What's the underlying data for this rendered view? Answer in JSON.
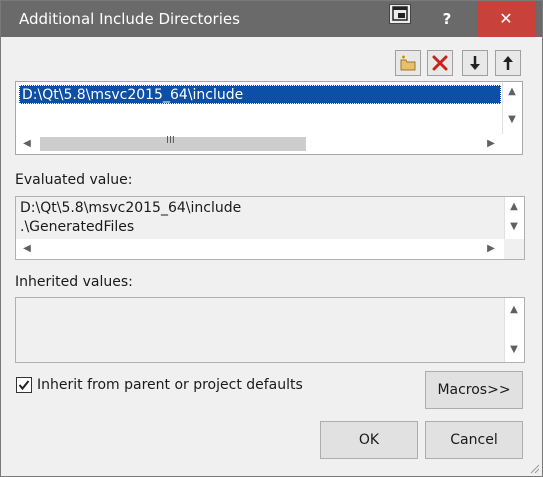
{
  "window": {
    "title": "Additional Include Directories",
    "help_label": "?",
    "close_label": "✕"
  },
  "toolbar": {
    "icons": [
      "new-folder-icon",
      "delete-icon",
      "move-down-icon",
      "move-up-icon"
    ]
  },
  "directories": {
    "items": [
      "D:\\Qt\\5.8\\msvc2015_64\\include"
    ],
    "selected_index": 0,
    "hscroll_thumb_glyph": "III"
  },
  "evaluated": {
    "label": "Evaluated value:",
    "lines": [
      "D:\\Qt\\5.8\\msvc2015_64\\include",
      ".\\GeneratedFiles"
    ]
  },
  "inherited": {
    "label": "Inherited values:",
    "lines": []
  },
  "inherit_checkbox": {
    "label": "Inherit from parent or project defaults",
    "checked": true
  },
  "buttons": {
    "macros": "Macros>>",
    "ok": "OK",
    "cancel": "Cancel"
  },
  "colors": {
    "titlebar": "#6a6a6a",
    "close": "#c8413a",
    "selection": "#0b4fa6",
    "dialog_bg": "#f0f0f0"
  }
}
